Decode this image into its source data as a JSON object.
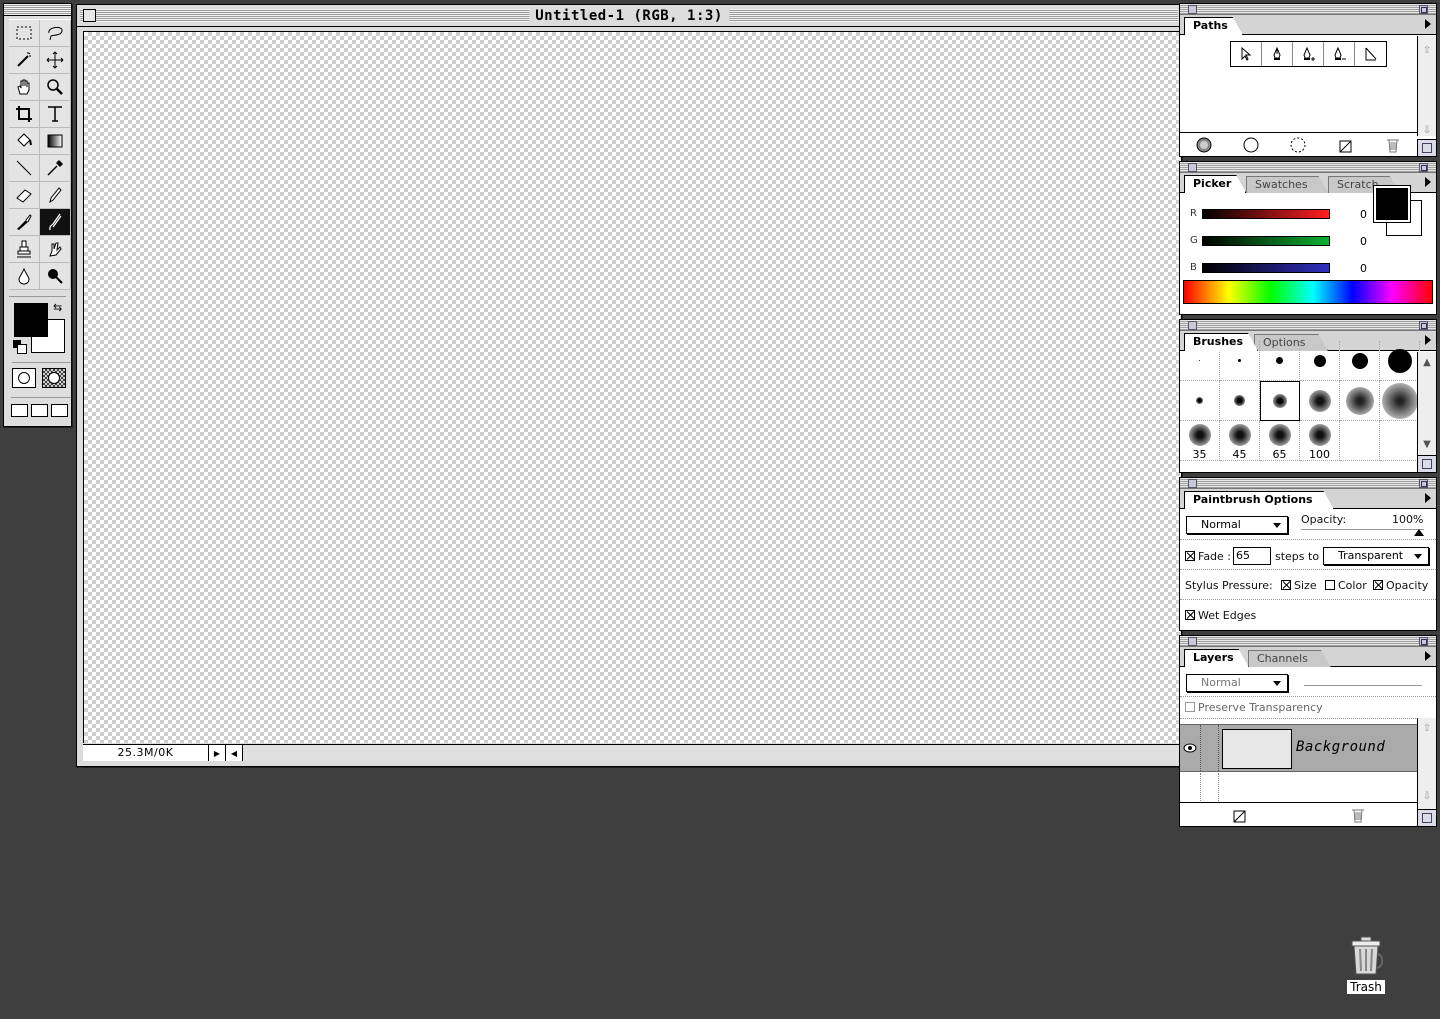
{
  "document": {
    "title": "Untitled-1  (RGB, 1:3)",
    "info": "25.3M/0K"
  },
  "paths_palette": {
    "tab": "Paths"
  },
  "picker_palette": {
    "tabs": [
      "Picker",
      "Swatches",
      "Scratch"
    ],
    "sliders": [
      {
        "label": "R",
        "value": "0",
        "gradient_from": "#000000",
        "gradient_to": "#ff2020"
      },
      {
        "label": "G",
        "value": "0",
        "gradient_from": "#000000",
        "gradient_to": "#10b030"
      },
      {
        "label": "B",
        "value": "0",
        "gradient_from": "#000000",
        "gradient_to": "#3030c0"
      }
    ],
    "foreground_color": "#000000",
    "background_color": "#ffffff"
  },
  "brushes_palette": {
    "tabs": [
      "Brushes",
      "Options"
    ],
    "labels": [
      "35",
      "45",
      "65",
      "100"
    ]
  },
  "paintbrush_options": {
    "tab": "Paintbrush Options",
    "mode": "Normal",
    "opacity_label": "Opacity:",
    "opacity_value": "100%",
    "fade_label": "Fade :",
    "fade_value": "65",
    "steps_to_label": "steps to",
    "fade_target": "Transparent",
    "stylus_label": "Stylus Pressure:",
    "size_label": "Size",
    "color_label": "Color",
    "opacity_check_label": "Opacity",
    "wet_edges_label": "Wet Edges"
  },
  "layers_palette": {
    "tabs": [
      "Layers",
      "Channels"
    ],
    "mode": "Normal",
    "preserve_label": "Preserve Transparency",
    "layers": [
      {
        "name": "Background"
      }
    ]
  },
  "desktop": {
    "trash_label": "Trash"
  }
}
